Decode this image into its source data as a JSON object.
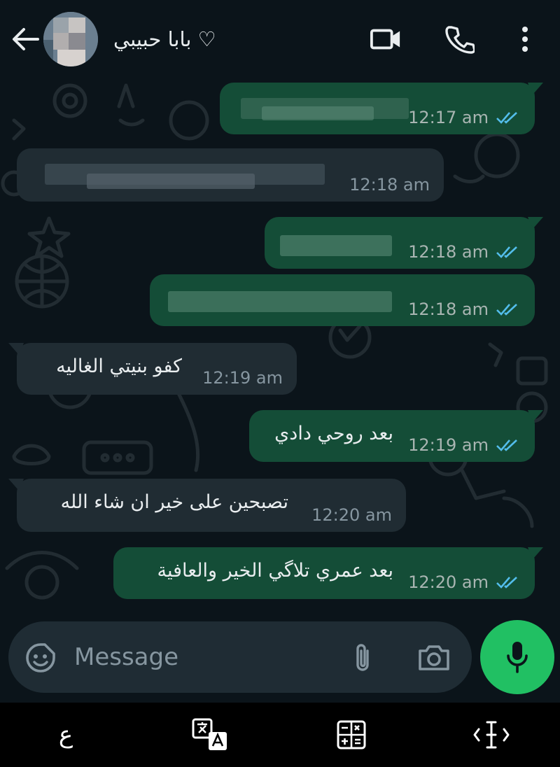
{
  "header": {
    "contact_name": "بابا حبيبي ♡",
    "icons": [
      "back-arrow-icon",
      "video-call-icon",
      "voice-call-icon",
      "more-options-icon"
    ]
  },
  "messages": [
    {
      "direction": "out",
      "text": "",
      "time": "12:17 am",
      "status": "read",
      "content_blurred": true
    },
    {
      "direction": "in",
      "text": "",
      "time": "12:18 am",
      "content_blurred": true
    },
    {
      "direction": "out",
      "text": "",
      "time": "12:18 am",
      "status": "read",
      "content_blurred": true
    },
    {
      "direction": "out",
      "text": "",
      "time": "12:18 am",
      "status": "read",
      "content_blurred": true
    },
    {
      "direction": "in",
      "text": "كفو بنيتي الغاليه",
      "time": "12:19 am"
    },
    {
      "direction": "out",
      "text": "بعد روحي دادي",
      "time": "12:19 am",
      "status": "read"
    },
    {
      "direction": "in",
      "text": "تصبحين على خير ان شاء الله",
      "time": "12:20 am"
    },
    {
      "direction": "out",
      "text": "بعد عمري تلاگي الخير والعافية",
      "time": "12:20 am",
      "status": "read"
    }
  ],
  "composer": {
    "placeholder": "Message",
    "icons": [
      "sticker-icon",
      "attach-paperclip-icon",
      "camera-icon",
      "mic-icon"
    ]
  },
  "keyboard_toolbar": {
    "items": [
      {
        "label": "ع",
        "icon": "arabic-letter-icon"
      },
      {
        "label": "",
        "icon": "translate-icon"
      },
      {
        "label": "",
        "icon": "calculator-icon"
      },
      {
        "label": "",
        "icon": "text-cursor-icon"
      }
    ]
  },
  "colors": {
    "background": "#0b141a",
    "outgoing_bubble": "#144d37",
    "incoming_bubble": "#202c33",
    "read_ticks": "#53bdeb",
    "mic_button": "#21c063",
    "input_bar": "#1f2c34"
  }
}
